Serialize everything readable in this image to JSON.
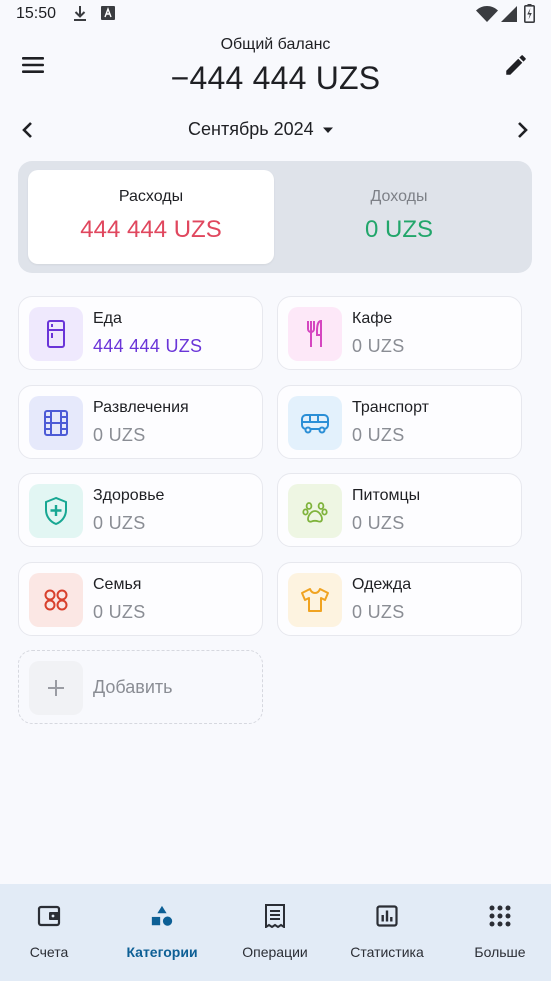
{
  "status_bar": {
    "time": "15:50"
  },
  "header": {
    "balance_label": "Общий баланс",
    "balance_value": "−444 444 UZS"
  },
  "period": {
    "month": "Сентябрь 2024"
  },
  "tabs": {
    "expense": {
      "label": "Расходы",
      "value": "444 444 UZS",
      "color": "#e0475e"
    },
    "income": {
      "label": "Доходы",
      "value": "0 UZS",
      "color": "#22a66b"
    }
  },
  "categories": [
    {
      "name": "Еда",
      "amount": "444 444 UZS",
      "icon": "fridge-icon",
      "color": "#6a35d8",
      "bg": "#efe9fd"
    },
    {
      "name": "Кафе",
      "amount": "0 UZS",
      "icon": "fork-knife-icon",
      "color": "#d546c0",
      "bg": "#fde8f8"
    },
    {
      "name": "Развлечения",
      "amount": "0 UZS",
      "icon": "film-icon",
      "color": "#4d5bd6",
      "bg": "#e6e9fb"
    },
    {
      "name": "Транспорт",
      "amount": "0 UZS",
      "icon": "bus-icon",
      "color": "#2b8fd6",
      "bg": "#e3f1fc"
    },
    {
      "name": "Здоровье",
      "amount": "0 UZS",
      "icon": "shield-plus-icon",
      "color": "#18a793",
      "bg": "#e2f6f3"
    },
    {
      "name": "Питомцы",
      "amount": "0 UZS",
      "icon": "paw-icon",
      "color": "#7fb33c",
      "bg": "#eef6e3"
    },
    {
      "name": "Семья",
      "amount": "0 UZS",
      "icon": "family-icon",
      "color": "#d8402c",
      "bg": "#fbe7e4"
    },
    {
      "name": "Одежда",
      "amount": "0 UZS",
      "icon": "tshirt-icon",
      "color": "#f0a321",
      "bg": "#fdf3e0"
    }
  ],
  "add_category": {
    "label": "Добавить"
  },
  "nav": [
    {
      "label": "Счета",
      "icon": "wallet-icon"
    },
    {
      "label": "Категории",
      "icon": "categories-icon",
      "active": true
    },
    {
      "label": "Операции",
      "icon": "receipt-icon"
    },
    {
      "label": "Статистика",
      "icon": "bar-chart-icon"
    },
    {
      "label": "Больше",
      "icon": "grid-dots-icon"
    }
  ],
  "colors": {
    "accent": "#0d5f95",
    "background": "#f8f9fd",
    "nav_background": "#e2ebf6"
  }
}
